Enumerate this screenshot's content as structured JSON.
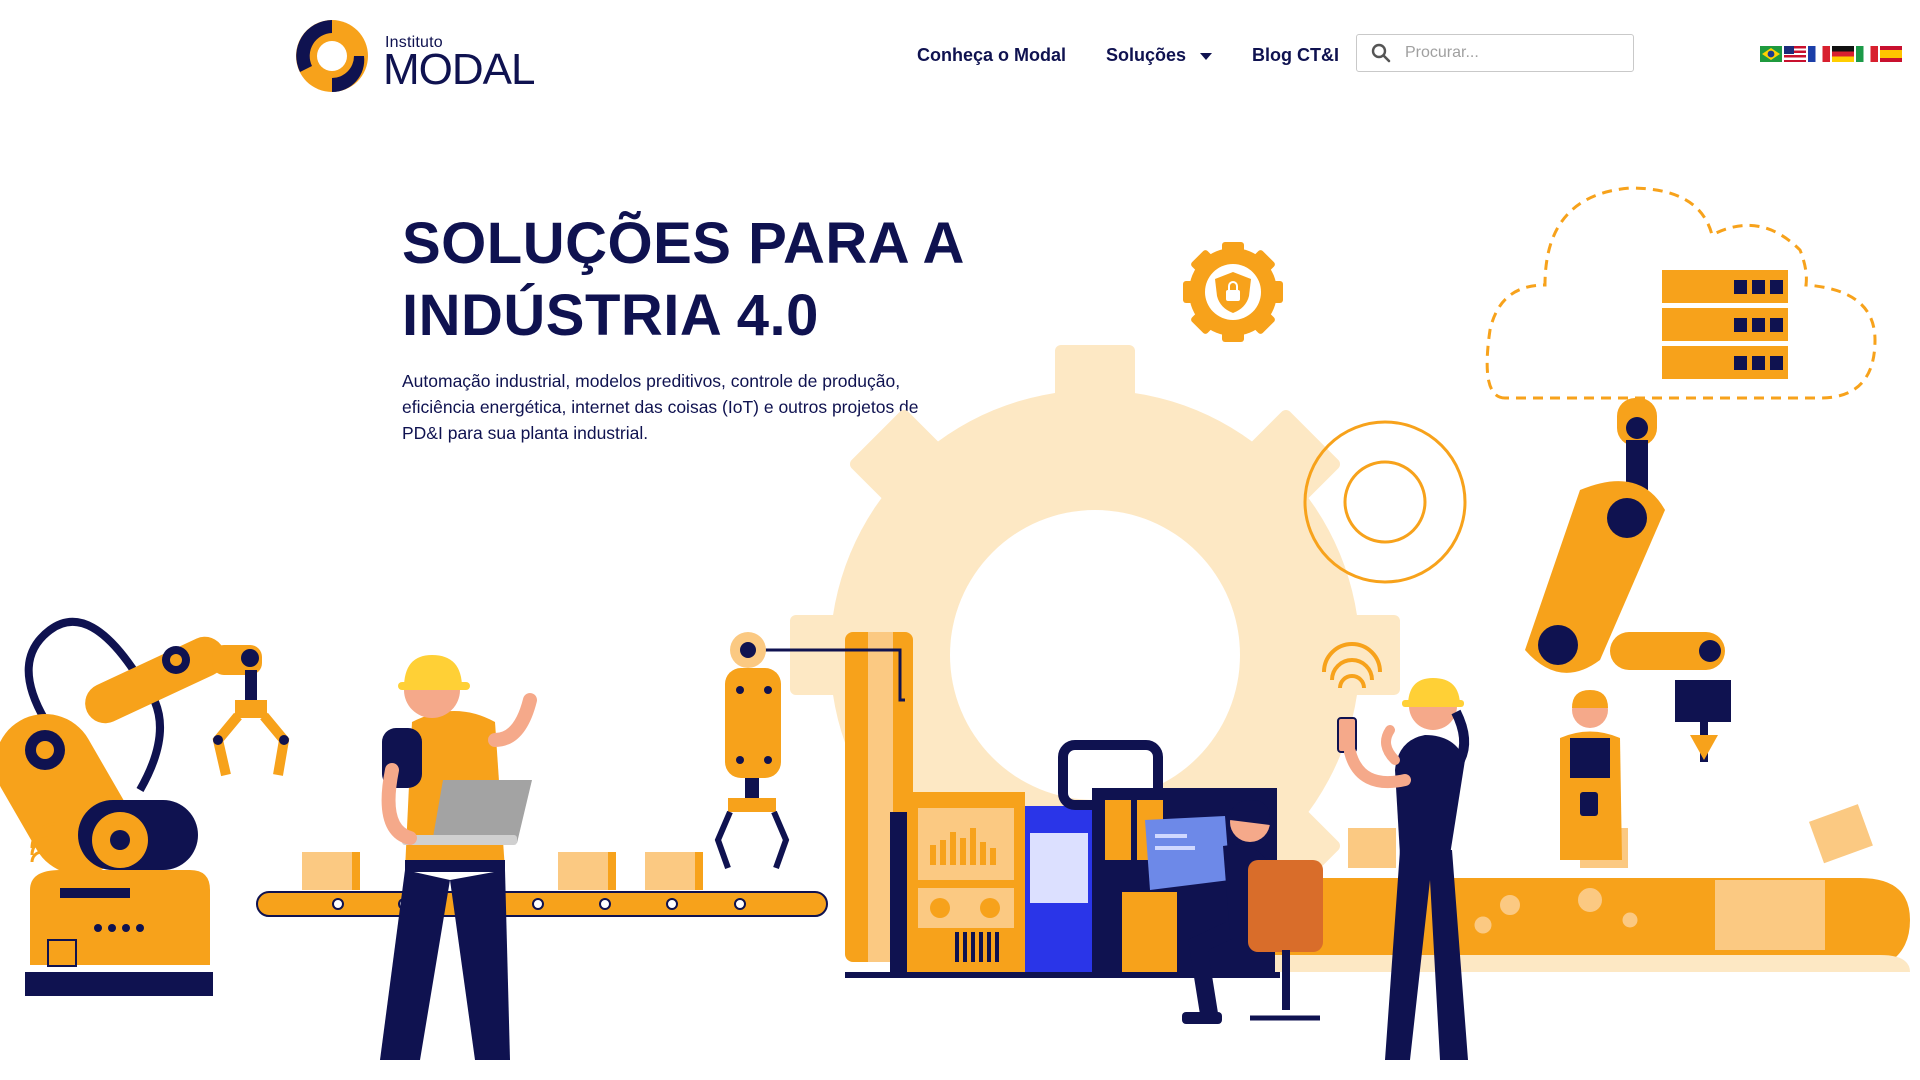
{
  "logo": {
    "small": "Instituto",
    "big": "MODAL"
  },
  "nav": {
    "items": [
      {
        "label": "Conheça o Modal"
      },
      {
        "label": "Soluções"
      },
      {
        "label": "Blog CT&I"
      }
    ]
  },
  "search": {
    "placeholder": "Procurar..."
  },
  "flags": [
    "brazil-flag",
    "usa-flag",
    "france-flag",
    "germany-flag",
    "italy-flag",
    "spain-flag"
  ],
  "hero": {
    "title_line1": "SOLUÇÕES PARA A",
    "title_line2": "INDÚSTRIA 4.0",
    "subtitle": "Automação industrial, modelos preditivos, controle de produção, eficiência energética, internet das coisas (IoT) e outros projetos de PD&I para sua planta industrial."
  },
  "colors": {
    "navy": "#0f1250",
    "orange": "#f7a21b",
    "light_orange": "#fde8c4",
    "blue": "#2a35e8",
    "skin": "#f5a98a"
  }
}
